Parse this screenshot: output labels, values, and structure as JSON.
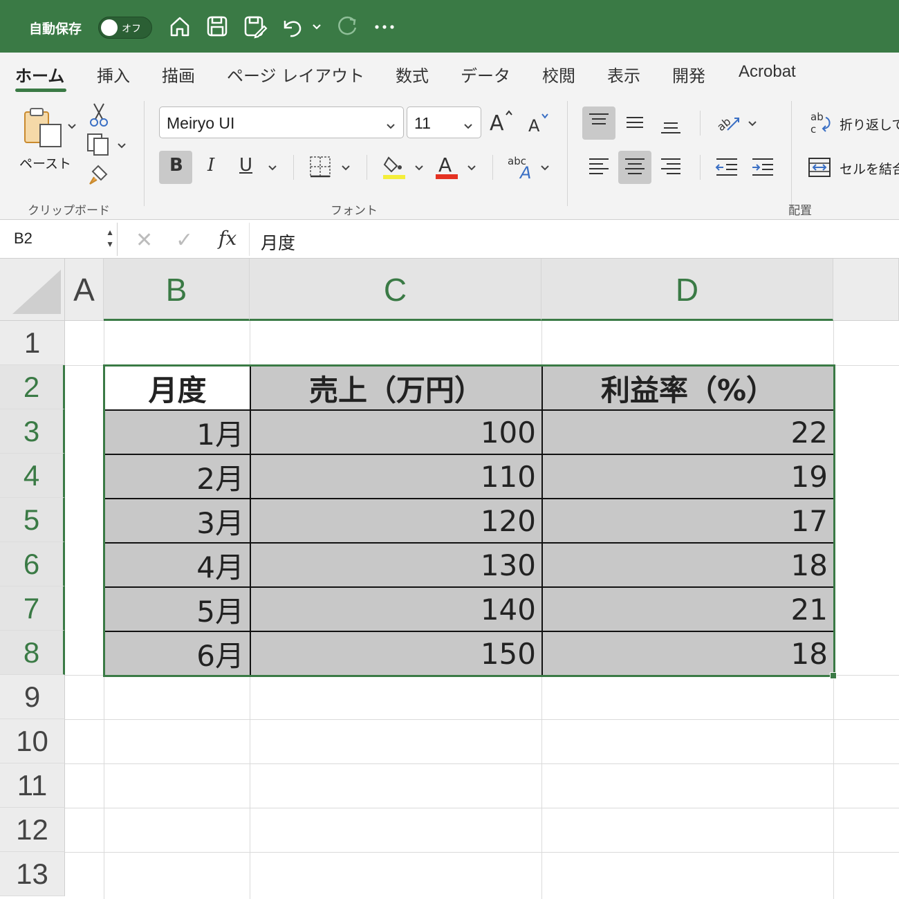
{
  "titlebar": {
    "autosave_label": "自動保存",
    "toggle_label": "オフ"
  },
  "tabs": [
    "ホーム",
    "挿入",
    "描画",
    "ページ レイアウト",
    "数式",
    "データ",
    "校閲",
    "表示",
    "開発",
    "Acrobat"
  ],
  "ribbon": {
    "paste_label": "ペースト",
    "clipboard_group": "クリップボード",
    "font_group": "フォント",
    "alignment_group": "配置",
    "font_name": "Meiryo UI",
    "font_size": "11",
    "bold_label": "B",
    "italic_label": "I",
    "underline_label": "U",
    "wrap_text_label": "折り返して",
    "merge_label": "セルを結合"
  },
  "formula_bar": {
    "name_box": "B2",
    "formula": "月度"
  },
  "sheet": {
    "columns": [
      "A",
      "B",
      "C",
      "D"
    ],
    "rows": [
      "1",
      "2",
      "3",
      "4",
      "5",
      "6",
      "7",
      "8",
      "9",
      "10",
      "11",
      "12",
      "13"
    ],
    "table": {
      "headers": [
        "月度",
        "売上（万円）",
        "利益率（%）"
      ],
      "rows": [
        [
          "1月",
          "100",
          "22"
        ],
        [
          "2月",
          "110",
          "19"
        ],
        [
          "3月",
          "120",
          "17"
        ],
        [
          "4月",
          "130",
          "18"
        ],
        [
          "5月",
          "140",
          "21"
        ],
        [
          "6月",
          "150",
          "18"
        ]
      ]
    }
  },
  "colors": {
    "accent": "#3a7a45",
    "cell_fill": "#c8c8c8"
  }
}
